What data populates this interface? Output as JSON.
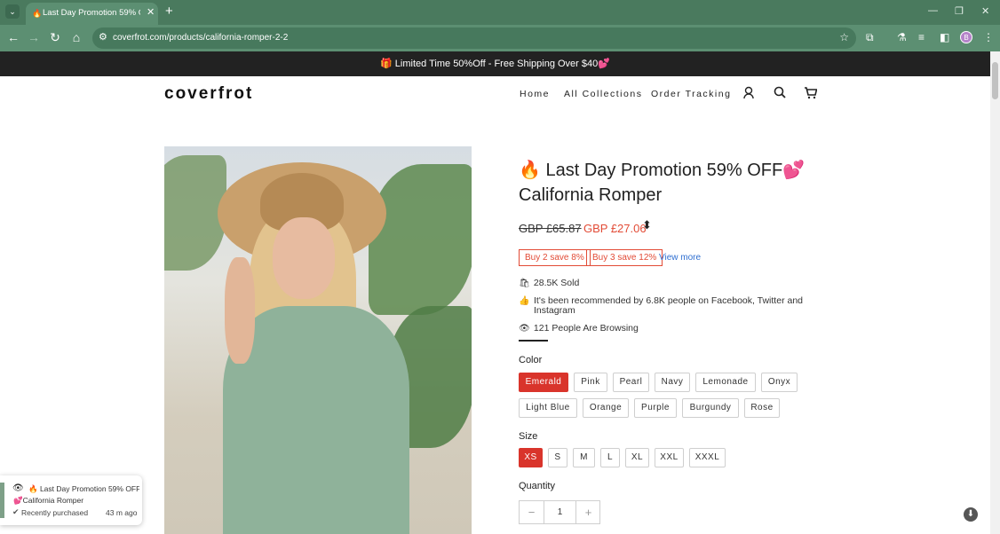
{
  "browser": {
    "tab_title": "Last Day Promotion 59% OFF California Romper",
    "tab_favicon": "🔥",
    "new_tab": "+",
    "close_tab": "✕",
    "url": "coverfrot.com/products/california-romper-2-2",
    "profile_initial": "B",
    "icons": [
      "back-icon",
      "forward-icon",
      "reload-icon",
      "home-icon",
      "site-info-icon",
      "star-icon",
      "extensions-icon",
      "labs-icon",
      "media-icon",
      "sidebar-icon",
      "menu-icon"
    ]
  },
  "announcement": "🎁 Limited Time 50%Off - Free Shipping Over $40💕",
  "header": {
    "logo": "coverfrot",
    "nav": [
      "Home",
      "All Collections",
      "Order Tracking"
    ]
  },
  "product": {
    "title": "🔥 Last Day Promotion 59% OFF💕 California Romper",
    "price_old": "GBP £65.87",
    "price_new": "GBP £27.06",
    "promos": [
      "Buy 2 save 8%",
      "Buy 3 save 12%"
    ],
    "promo_more": "View more",
    "sold": "28.5K Sold",
    "recommended": "It's been recommended by 6.8K people on Facebook, Twitter and Instagram",
    "browsing": "121 People Are Browsing",
    "color_label": "Color",
    "colors": [
      "Emerald",
      "Pink",
      "Pearl",
      "Navy",
      "Lemonade",
      "Onyx",
      "Light Blue",
      "Orange",
      "Purple",
      "Burgundy",
      "Rose"
    ],
    "selected_color": "Emerald",
    "size_label": "Size",
    "sizes": [
      "XS",
      "S",
      "M",
      "L",
      "XL",
      "XXL",
      "XXXL"
    ],
    "selected_size": "XS",
    "quantity_label": "Quantity",
    "quantity": "1",
    "qty_minus": "−",
    "qty_plus": "+"
  },
  "toast": {
    "line1": "🔥 Last Day Promotion 59% OFF",
    "line2": "💕California Romper",
    "line3": "Recently purchased",
    "time": "43 m ago"
  },
  "colors": {
    "accent": "#d9342b",
    "price": "#e24b36",
    "chrome": "#5c8f72",
    "link": "#2f6fd1"
  }
}
